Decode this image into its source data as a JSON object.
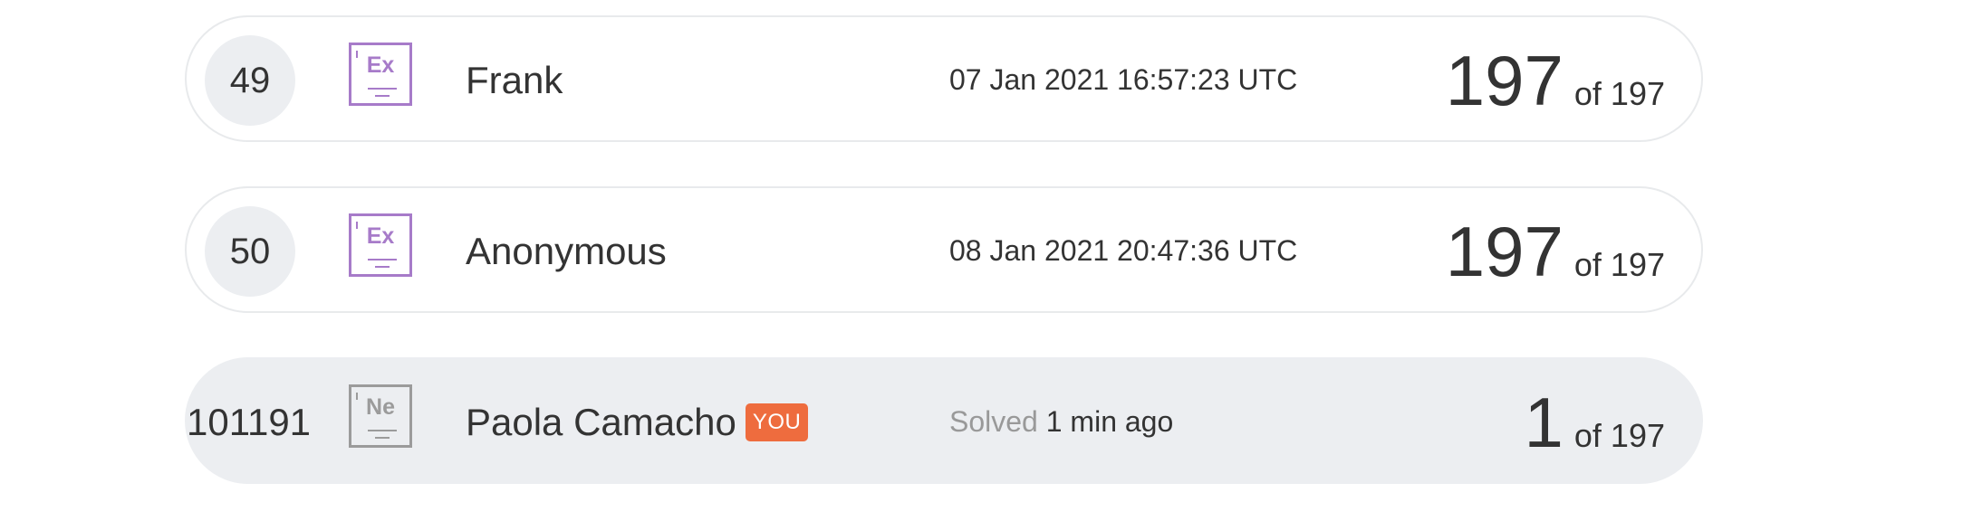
{
  "leaderboard": {
    "rows": [
      {
        "rank": "49",
        "badge_symbol": "Ex",
        "badge_icon": "element-badge-icon",
        "name": "Frank",
        "time": "07 Jan 2021 16:57:23 UTC",
        "score": "197",
        "of_text": "of 197"
      },
      {
        "rank": "50",
        "badge_symbol": "Ex",
        "badge_icon": "element-badge-icon",
        "name": "Anonymous",
        "time": "08 Jan 2021 20:47:36 UTC",
        "score": "197",
        "of_text": "of 197"
      }
    ],
    "current_user": {
      "rank": "101191",
      "badge_symbol": "Ne",
      "badge_icon": "element-badge-icon",
      "name": "Paola Camacho",
      "you_label": "YOU",
      "solved_label": "Solved",
      "solved_time": "1 min ago",
      "score": "1",
      "of_text": "of 197"
    }
  },
  "colors": {
    "badge_purple": "#a77bc9",
    "badge_gray": "#9b9b9b",
    "you_badge": "#ee6c3e",
    "current_row_bg": "#eceef1",
    "rank_circle": "#eceef1"
  }
}
